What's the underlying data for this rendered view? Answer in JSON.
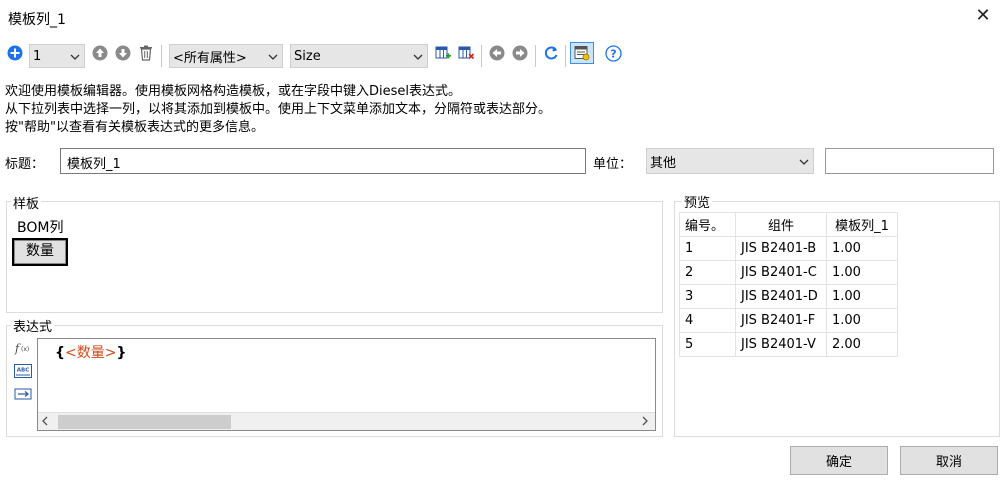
{
  "window": {
    "title": "模板列_1",
    "close_glyph": "✕"
  },
  "toolbar": {
    "level_value": "1",
    "property_filter": "<所有属性>",
    "property_select": "Size",
    "icons": [
      "add-icon",
      "move-up-icon",
      "move-down-icon",
      "delete-icon",
      "insert-column-icon",
      "delete-column-icon",
      "back-icon",
      "forward-icon",
      "refresh-icon",
      "preview-toggle-icon",
      "help-icon"
    ],
    "accent": "#1a73e8"
  },
  "intro": {
    "line1": "欢迎使用模板编辑器。使用模板网格构造模板，或在字段中键入Diesel表达式。",
    "line2": "从下拉列表中选择一列，以将其添加到模板中。使用上下文菜单添加文本，分隔符或表达部分。",
    "line3": "按\"帮助\"以查看有关模板表达式的更多信息。"
  },
  "form": {
    "title_label": "标题：",
    "title_value": "模板列_1",
    "unit_label": "单位：",
    "unit_value": "其他",
    "unit_extra_value": ""
  },
  "sample": {
    "group_title": "样板",
    "column_label": "BOM列",
    "chip_label": "数量"
  },
  "expression": {
    "group_title": "表达式",
    "brace_open": "{",
    "field": "<数量>",
    "brace_close": "}",
    "field_color": "#d04a1a"
  },
  "preview": {
    "group_title": "预览",
    "headers": [
      "编号。",
      "组件",
      "模板列_1"
    ],
    "rows": [
      [
        "1",
        "JIS B2401-B",
        "1.00"
      ],
      [
        "2",
        "JIS B2401-C",
        "1.00"
      ],
      [
        "3",
        "JIS B2401-D",
        "1.00"
      ],
      [
        "4",
        "JIS B2401-F",
        "1.00"
      ],
      [
        "5",
        "JIS B2401-V",
        "2.00"
      ]
    ]
  },
  "buttons": {
    "ok": "确定",
    "cancel": "取消"
  }
}
